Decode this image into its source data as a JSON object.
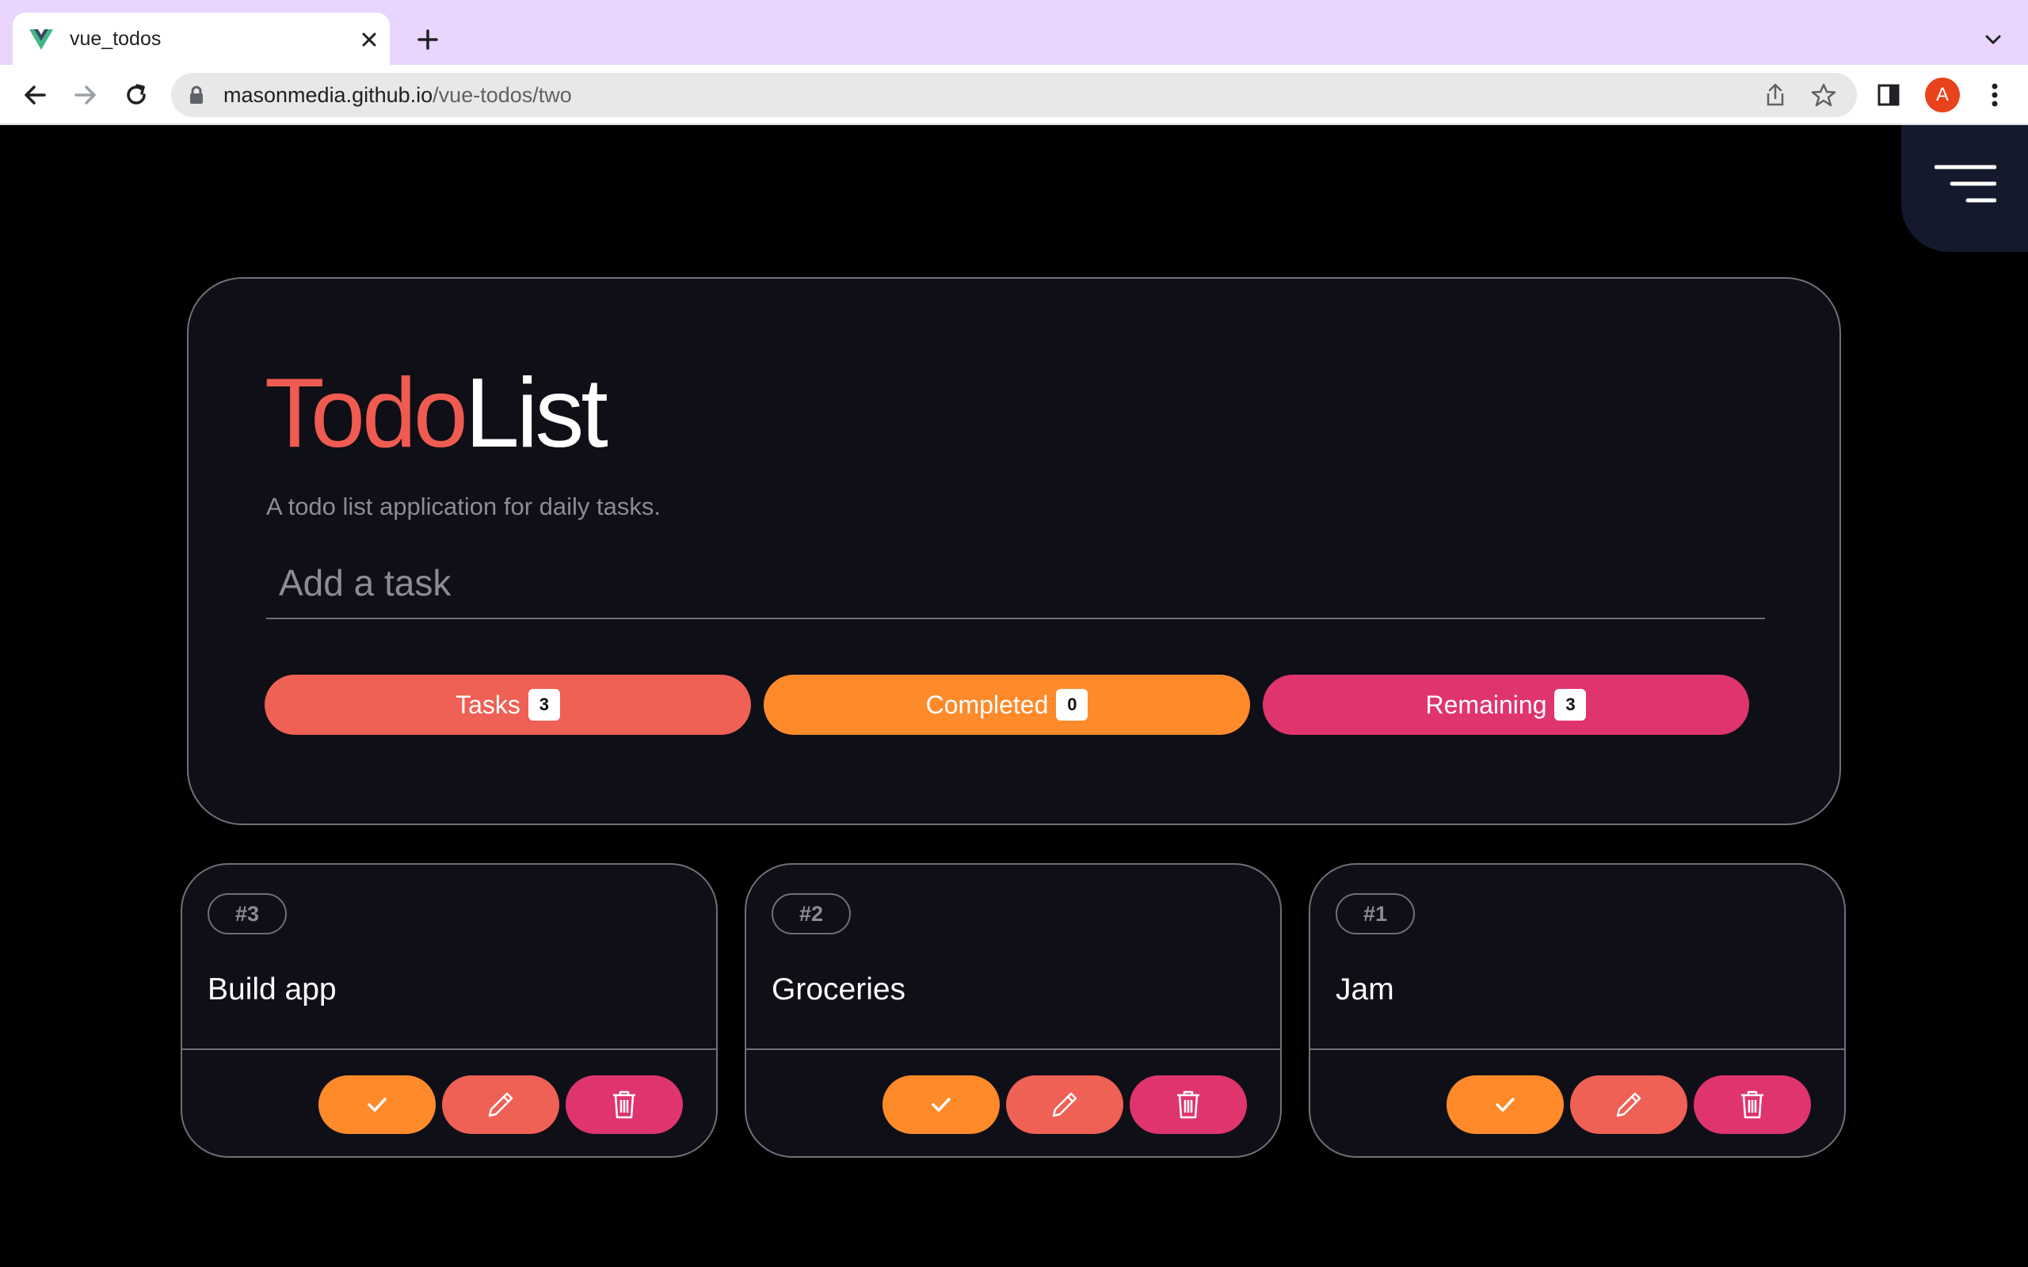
{
  "browser": {
    "tab_title": "vue_todos",
    "url_host": "masonmedia.github.io",
    "url_path": "/vue-todos/two",
    "profile_initial": "A"
  },
  "header": {
    "title_part1": "Todo",
    "title_part2": "List",
    "subtitle": "A todo list application for daily tasks.",
    "input_placeholder": "Add a task"
  },
  "stats": [
    {
      "label": "Tasks",
      "count": "3",
      "color": "#ef6055"
    },
    {
      "label": "Completed",
      "count": "0",
      "color": "#fe8a2a"
    },
    {
      "label": "Remaining",
      "count": "3",
      "color": "#e0346f"
    }
  ],
  "tasks": [
    {
      "number": "#3",
      "name": "Build app"
    },
    {
      "number": "#2",
      "name": "Groceries"
    },
    {
      "number": "#1",
      "name": "Jam"
    }
  ],
  "icons": {
    "complete": "check-icon",
    "edit": "pencil-icon",
    "delete": "trash-icon",
    "menu": "hamburger-menu-icon"
  }
}
